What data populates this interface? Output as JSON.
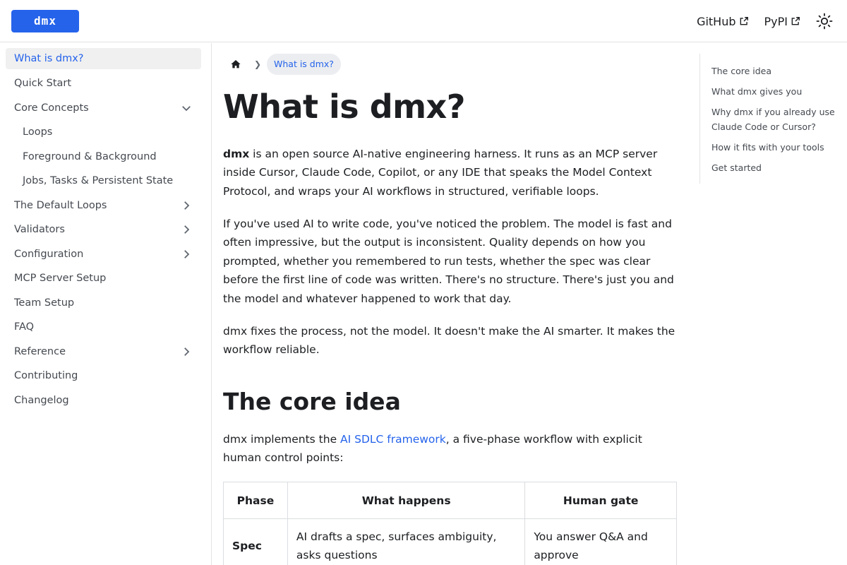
{
  "navbar": {
    "brand": "dmx",
    "links": [
      {
        "label": "GitHub"
      },
      {
        "label": "PyPI"
      }
    ]
  },
  "sidebar": {
    "items": [
      {
        "label": "What is dmx?"
      },
      {
        "label": "Quick Start"
      },
      {
        "label": "Core Concepts"
      },
      {
        "label": "Loops"
      },
      {
        "label": "Foreground & Background"
      },
      {
        "label": "Jobs, Tasks & Persistent State"
      },
      {
        "label": "The Default Loops"
      },
      {
        "label": "Validators"
      },
      {
        "label": "Configuration"
      },
      {
        "label": "MCP Server Setup"
      },
      {
        "label": "Team Setup"
      },
      {
        "label": "FAQ"
      },
      {
        "label": "Reference"
      },
      {
        "label": "Contributing"
      },
      {
        "label": "Changelog"
      }
    ]
  },
  "breadcrumb": {
    "current": "What is dmx?"
  },
  "content": {
    "title": "What is dmx?",
    "intro_bold": "dmx",
    "intro_rest": " is an open source AI-native engineering harness. It runs as an MCP server inside Cursor, Claude Code, Copilot, or any IDE that speaks the Model Context Protocol, and wraps your AI workflows in structured, verifiable loops.",
    "para2": "If you've used AI to write code, you've noticed the problem. The model is fast and often impressive, but the output is inconsistent. Quality depends on how you prompted, whether you remembered to run tests, whether the spec was clear before the first line of code was written. There's no structure. There's just you and the model and whatever happened to work that day.",
    "para3": "dmx fixes the process, not the model. It doesn't make the AI smarter. It makes the workflow reliable.",
    "section_title": "The core idea",
    "core_before": "dmx implements the ",
    "core_link": "AI SDLC framework",
    "core_after": ", a five-phase workflow with explicit human control points:",
    "table": {
      "headers": [
        "Phase",
        "What happens",
        "Human gate"
      ],
      "rows": [
        [
          "Spec",
          "AI drafts a spec, surfaces ambiguity, asks questions",
          "You answer Q&A and approve"
        ]
      ]
    }
  },
  "toc": {
    "items": [
      {
        "label": "The core idea"
      },
      {
        "label": "What dmx gives you"
      },
      {
        "label": "Why dmx if you already use Claude Code or Cursor?"
      },
      {
        "label": "How it fits with your tools"
      },
      {
        "label": "Get started"
      }
    ]
  },
  "colors": {
    "accent": "#2563eb",
    "active_bg": "#f0f0f0",
    "border": "#e3e3e3"
  }
}
